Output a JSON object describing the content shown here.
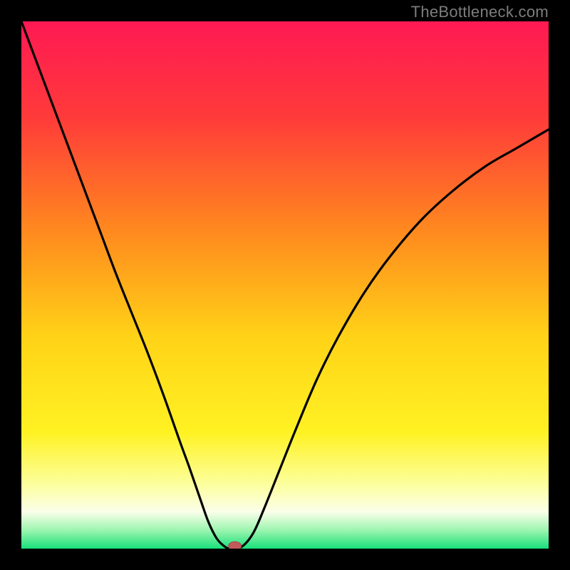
{
  "watermark": "TheBottleneck.com",
  "colors": {
    "background": "#000000",
    "curve": "#000000",
    "marker_fill": "#c15a5a",
    "marker_stroke": "#a64646",
    "gradient_stops": [
      {
        "offset": 0.0,
        "color": "#ff1954"
      },
      {
        "offset": 0.18,
        "color": "#ff3a3a"
      },
      {
        "offset": 0.4,
        "color": "#ff8a1e"
      },
      {
        "offset": 0.6,
        "color": "#ffd317"
      },
      {
        "offset": 0.78,
        "color": "#fff223"
      },
      {
        "offset": 0.88,
        "color": "#fcffa0"
      },
      {
        "offset": 0.93,
        "color": "#fbffea"
      },
      {
        "offset": 0.965,
        "color": "#9cf5b0"
      },
      {
        "offset": 1.0,
        "color": "#18e07a"
      }
    ]
  },
  "chart_data": {
    "type": "line",
    "title": "",
    "xlabel": "",
    "ylabel": "",
    "xlim": [
      0,
      1
    ],
    "ylim": [
      0,
      1
    ],
    "marker": {
      "x": 0.405,
      "y": 0.005
    },
    "series": [
      {
        "name": "curve",
        "x": [
          0.0,
          0.03,
          0.06,
          0.09,
          0.12,
          0.15,
          0.18,
          0.21,
          0.24,
          0.27,
          0.3,
          0.32,
          0.34,
          0.355,
          0.37,
          0.383,
          0.393,
          0.403,
          0.42,
          0.44,
          0.46,
          0.49,
          0.52,
          0.56,
          0.6,
          0.65,
          0.7,
          0.76,
          0.82,
          0.88,
          0.94,
          1.0
        ],
        "y": [
          1.0,
          0.92,
          0.84,
          0.76,
          0.68,
          0.6,
          0.52,
          0.445,
          0.37,
          0.29,
          0.205,
          0.15,
          0.092,
          0.05,
          0.02,
          0.006,
          0.0,
          0.0,
          0.005,
          0.03,
          0.075,
          0.15,
          0.225,
          0.32,
          0.4,
          0.485,
          0.555,
          0.625,
          0.68,
          0.725,
          0.76,
          0.795
        ]
      }
    ]
  }
}
